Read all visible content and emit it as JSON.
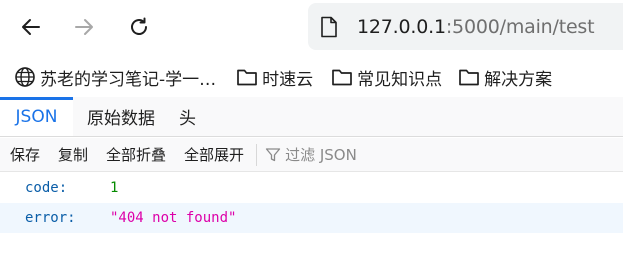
{
  "nav": {
    "back_icon": "arrow-left-icon",
    "forward_icon": "arrow-right-icon",
    "reload_icon": "reload-icon",
    "url_host": "127.0.0.1",
    "url_path": ":5000/main/test"
  },
  "bookmarks": [
    {
      "icon": "globe-icon",
      "label": "苏老的学习笔记-学一…"
    },
    {
      "icon": "folder-icon",
      "label": "时速云"
    },
    {
      "icon": "folder-icon",
      "label": "常见知识点"
    },
    {
      "icon": "folder-icon",
      "label": "解决方案"
    }
  ],
  "viewer_tabs": [
    {
      "label": "JSON",
      "active": true
    },
    {
      "label": "原始数据",
      "active": false
    },
    {
      "label": "头",
      "active": false
    }
  ],
  "toolbar": {
    "save": "保存",
    "copy": "复制",
    "collapse_all": "全部折叠",
    "expand_all": "全部展开",
    "filter_placeholder": "过滤 JSON"
  },
  "json": [
    {
      "key": "code:",
      "value": "1",
      "type": "number"
    },
    {
      "key": "error:",
      "value": "\"404 not found\"",
      "type": "string"
    }
  ],
  "colors": {
    "accent": "#1a73e8",
    "key": "#0b5ea8",
    "number": "#058b00",
    "string": "#dd00a9"
  }
}
